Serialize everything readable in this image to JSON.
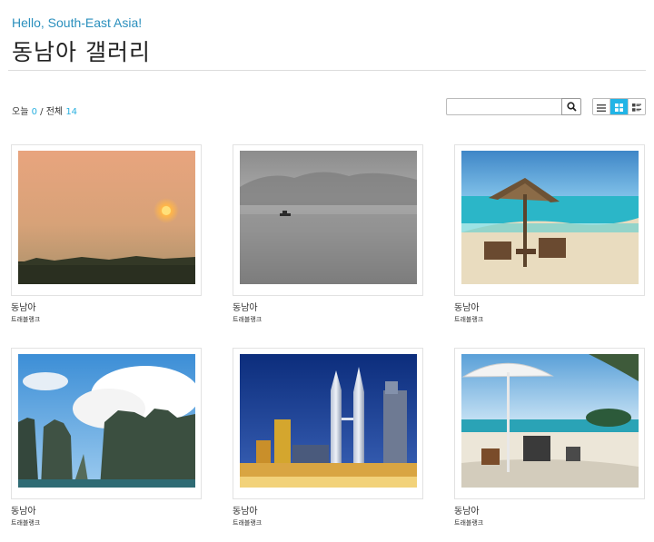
{
  "header": {
    "greeting": "Hello, South-East Asia!",
    "title": "동남아 갤러리"
  },
  "stats": {
    "today_label": "오늘",
    "today_count": "0",
    "separator": "/",
    "total_label": "전체",
    "total_count": "14"
  },
  "search": {
    "value": "",
    "placeholder": "",
    "button_icon": "search-icon"
  },
  "view_modes": [
    {
      "icon": "list-view-icon",
      "active": false
    },
    {
      "icon": "grid-view-icon",
      "active": true
    },
    {
      "icon": "detail-view-icon",
      "active": false
    }
  ],
  "gallery": {
    "items": [
      {
        "title": "동남아",
        "author": "트래블랭크",
        "image": "sunset-over-fields"
      },
      {
        "title": "동남아",
        "author": "트래블랭크",
        "image": "misty-river-boat"
      },
      {
        "title": "동남아",
        "author": "트래블랭크",
        "image": "beach-umbrella-chairs"
      },
      {
        "title": "동남아",
        "author": "트래블랭크",
        "image": "limestone-karsts-bay"
      },
      {
        "title": "동남아",
        "author": "트래블랭크",
        "image": "twin-towers-night"
      },
      {
        "title": "동남아",
        "author": "트래블랭크",
        "image": "tropical-beach-umbrella"
      }
    ]
  },
  "colors": {
    "accent": "#22b4e6",
    "greeting": "#2a8fbd",
    "count": "#2bb0e0"
  }
}
